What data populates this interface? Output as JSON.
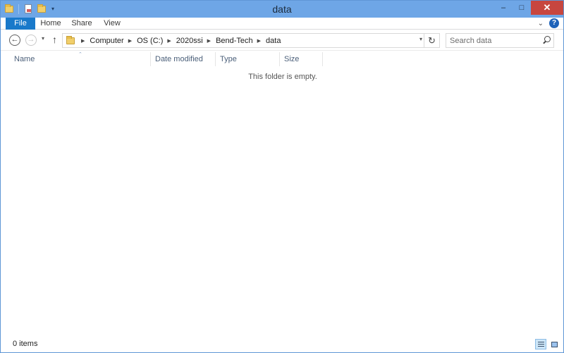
{
  "window": {
    "title": "data",
    "controls": {
      "minimize": "–",
      "maximize": "□",
      "close": "✕"
    }
  },
  "quick_access": {
    "icons": [
      "folder-icon",
      "properties-icon",
      "new-folder-icon"
    ],
    "dropdown": "▾"
  },
  "ribbon": {
    "tabs": [
      {
        "label": "File",
        "active": true
      },
      {
        "label": "Home"
      },
      {
        "label": "Share"
      },
      {
        "label": "View"
      }
    ],
    "collapse": "⌄",
    "help": "?"
  },
  "navigation": {
    "back": "←",
    "forward": "→",
    "recent": "▾",
    "up": "↑"
  },
  "address_bar": {
    "breadcrumbs": [
      "Computer",
      "OS (C:)",
      "2020ssi",
      "Bend-Tech",
      "data"
    ],
    "separator": "▶",
    "dropdown": "▾",
    "refresh": "↻"
  },
  "search": {
    "placeholder": "Search data"
  },
  "columns": [
    {
      "label": "Name",
      "sorted": true
    },
    {
      "label": "Date modified"
    },
    {
      "label": "Type"
    },
    {
      "label": "Size"
    }
  ],
  "sort_arrow": "⌃",
  "empty_message": "This folder is empty.",
  "status": {
    "item_count": "0 items"
  },
  "colors": {
    "title_bar": "#6ea6e6",
    "file_tab": "#1979ca",
    "close_button": "#c7463f",
    "header_text": "#4c607a"
  }
}
